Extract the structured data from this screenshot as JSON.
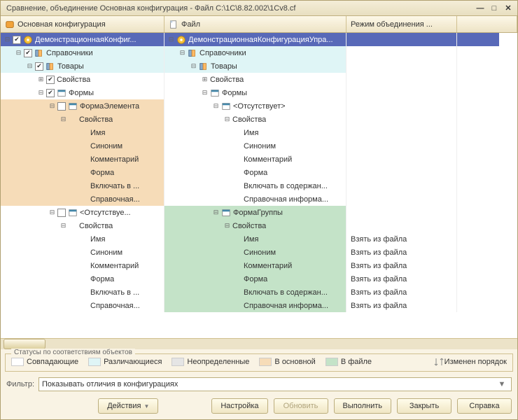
{
  "title": "Сравнение, объединение Основная конфигурация - Файл C:\\1C\\8.82.002\\1Cv8.cf",
  "columns": {
    "c1": "Основная конфигурация",
    "c2": "Файл",
    "c3": "Режим объединения ..."
  },
  "tree": [
    {
      "id": "r0",
      "sel": true,
      "c1": {
        "indent": 1,
        "exp": "minus",
        "chk": "on",
        "icon": "conf",
        "label": "ДемонстрационнаяКонфиг..."
      },
      "c2": {
        "indent": 1,
        "exp": "minus",
        "chk": "none",
        "icon": "conf",
        "label": "ДемонстрационнаяКонфигурацияУпра..."
      }
    },
    {
      "id": "r1",
      "bg": "cyan",
      "c1": {
        "indent": 2,
        "exp": "minus",
        "chk": "on",
        "icon": "book",
        "label": "Справочники"
      },
      "c2": {
        "indent": 2,
        "exp": "minus",
        "chk": "none",
        "icon": "book",
        "label": "Справочники"
      }
    },
    {
      "id": "r2",
      "bg": "cyan",
      "c1": {
        "indent": 3,
        "exp": "minus",
        "chk": "on",
        "icon": "book",
        "label": "Товары"
      },
      "c2": {
        "indent": 3,
        "exp": "minus",
        "chk": "none",
        "icon": "book",
        "label": "Товары"
      }
    },
    {
      "id": "r3",
      "c1": {
        "indent": 4,
        "exp": "plus",
        "chk": "on",
        "icon": "none",
        "label": "Свойства"
      },
      "c2": {
        "indent": 4,
        "exp": "plus",
        "chk": "none",
        "icon": "none",
        "label": "Свойства"
      }
    },
    {
      "id": "r4",
      "c1": {
        "indent": 4,
        "exp": "minus",
        "chk": "on",
        "icon": "form",
        "label": "Формы"
      },
      "c2": {
        "indent": 4,
        "exp": "minus",
        "chk": "none",
        "icon": "form",
        "label": "Формы"
      }
    },
    {
      "id": "r5",
      "bg": "peach",
      "c1": {
        "indent": 5,
        "exp": "minus",
        "chk": "off",
        "icon": "form",
        "label": "ФормаЭлемента"
      },
      "c2": {
        "indent": 5,
        "exp": "minus",
        "chk": "none",
        "icon": "form",
        "label": "<Отсутствует>"
      }
    },
    {
      "id": "r6",
      "bg": "peach",
      "c1": {
        "indent": 6,
        "exp": "minus",
        "chk": "none",
        "icon": "none",
        "label": "Свойства"
      },
      "c2": {
        "indent": 6,
        "exp": "minus",
        "chk": "none",
        "icon": "none",
        "label": "Свойства"
      }
    },
    {
      "id": "r7",
      "bg": "peach",
      "c1": {
        "indent": 7,
        "exp": "none",
        "chk": "none",
        "icon": "none",
        "label": "Имя"
      },
      "c2": {
        "indent": 7,
        "exp": "none",
        "chk": "none",
        "icon": "none",
        "label": "Имя"
      }
    },
    {
      "id": "r8",
      "bg": "peach",
      "c1": {
        "indent": 7,
        "exp": "none",
        "chk": "none",
        "icon": "none",
        "label": "Синоним"
      },
      "c2": {
        "indent": 7,
        "exp": "none",
        "chk": "none",
        "icon": "none",
        "label": "Синоним"
      }
    },
    {
      "id": "r9",
      "bg": "peach",
      "c1": {
        "indent": 7,
        "exp": "none",
        "chk": "none",
        "icon": "none",
        "label": "Комментарий"
      },
      "c2": {
        "indent": 7,
        "exp": "none",
        "chk": "none",
        "icon": "none",
        "label": "Комментарий"
      }
    },
    {
      "id": "r10",
      "bg": "peach",
      "c1": {
        "indent": 7,
        "exp": "none",
        "chk": "none",
        "icon": "none",
        "label": "Форма"
      },
      "c2": {
        "indent": 7,
        "exp": "none",
        "chk": "none",
        "icon": "none",
        "label": "Форма"
      }
    },
    {
      "id": "r11",
      "bg": "peach",
      "c1": {
        "indent": 7,
        "exp": "none",
        "chk": "none",
        "icon": "none",
        "label": "Включать в ..."
      },
      "c2": {
        "indent": 7,
        "exp": "none",
        "chk": "none",
        "icon": "none",
        "label": "Включать в содержан..."
      }
    },
    {
      "id": "r12",
      "bg": "peach",
      "c1": {
        "indent": 7,
        "exp": "none",
        "chk": "none",
        "icon": "none",
        "label": "Справочная..."
      },
      "c2": {
        "indent": 7,
        "exp": "none",
        "chk": "none",
        "icon": "none",
        "label": "Справочная информа..."
      }
    },
    {
      "id": "r13",
      "bg": "green",
      "c1": {
        "indent": 5,
        "exp": "minus",
        "chk": "off",
        "icon": "form",
        "label": "<Отсутствуе..."
      },
      "c2": {
        "indent": 5,
        "exp": "minus",
        "chk": "none",
        "icon": "form",
        "label": "ФормаГруппы"
      }
    },
    {
      "id": "r14",
      "bg": "green",
      "c1": {
        "indent": 6,
        "exp": "minus",
        "chk": "none",
        "icon": "none",
        "label": "Свойства"
      },
      "c2": {
        "indent": 6,
        "exp": "minus",
        "chk": "none",
        "icon": "none",
        "label": "Свойства"
      }
    },
    {
      "id": "r15",
      "bg": "green",
      "c1": {
        "indent": 7,
        "exp": "none",
        "chk": "none",
        "icon": "none",
        "label": "Имя"
      },
      "c2": {
        "indent": 7,
        "exp": "none",
        "chk": "none",
        "icon": "none",
        "label": "Имя"
      },
      "c3": "Взять из файла"
    },
    {
      "id": "r16",
      "bg": "green",
      "c1": {
        "indent": 7,
        "exp": "none",
        "chk": "none",
        "icon": "none",
        "label": "Синоним"
      },
      "c2": {
        "indent": 7,
        "exp": "none",
        "chk": "none",
        "icon": "none",
        "label": "Синоним"
      },
      "c3": "Взять из файла"
    },
    {
      "id": "r17",
      "bg": "green",
      "c1": {
        "indent": 7,
        "exp": "none",
        "chk": "none",
        "icon": "none",
        "label": "Комментарий"
      },
      "c2": {
        "indent": 7,
        "exp": "none",
        "chk": "none",
        "icon": "none",
        "label": "Комментарий"
      },
      "c3": "Взять из файла"
    },
    {
      "id": "r18",
      "bg": "green",
      "c1": {
        "indent": 7,
        "exp": "none",
        "chk": "none",
        "icon": "none",
        "label": "Форма"
      },
      "c2": {
        "indent": 7,
        "exp": "none",
        "chk": "none",
        "icon": "none",
        "label": "Форма"
      },
      "c3": "Взять из файла"
    },
    {
      "id": "r19",
      "bg": "green",
      "c1": {
        "indent": 7,
        "exp": "none",
        "chk": "none",
        "icon": "none",
        "label": "Включать в ..."
      },
      "c2": {
        "indent": 7,
        "exp": "none",
        "chk": "none",
        "icon": "none",
        "label": "Включать в содержан..."
      },
      "c3": "Взять из файла"
    },
    {
      "id": "r20",
      "bg": "green",
      "c1": {
        "indent": 7,
        "exp": "none",
        "chk": "none",
        "icon": "none",
        "label": "Справочная..."
      },
      "c2": {
        "indent": 7,
        "exp": "none",
        "chk": "none",
        "icon": "none",
        "label": "Справочная информа..."
      },
      "c3": "Взять из файла"
    }
  ],
  "legend": {
    "title": "Статусы по соответствиям объектов",
    "items": [
      {
        "color": "#ffffff",
        "label": "Совпадающие"
      },
      {
        "color": "#dff5f6",
        "label": "Различающиеся"
      },
      {
        "color": "#e5e5e5",
        "label": "Неопределенные"
      },
      {
        "color": "#f6dcb8",
        "label": "В основной"
      },
      {
        "color": "#c4e3c8",
        "label": "В файле"
      }
    ],
    "order": "Изменен порядок"
  },
  "filter": {
    "label": "Фильтр:",
    "value": "Показывать отличия в конфигурациях"
  },
  "buttons": {
    "actions": "Действия",
    "settings": "Настройка",
    "refresh": "Обновить",
    "execute": "Выполнить",
    "close": "Закрыть",
    "help": "Справка"
  }
}
